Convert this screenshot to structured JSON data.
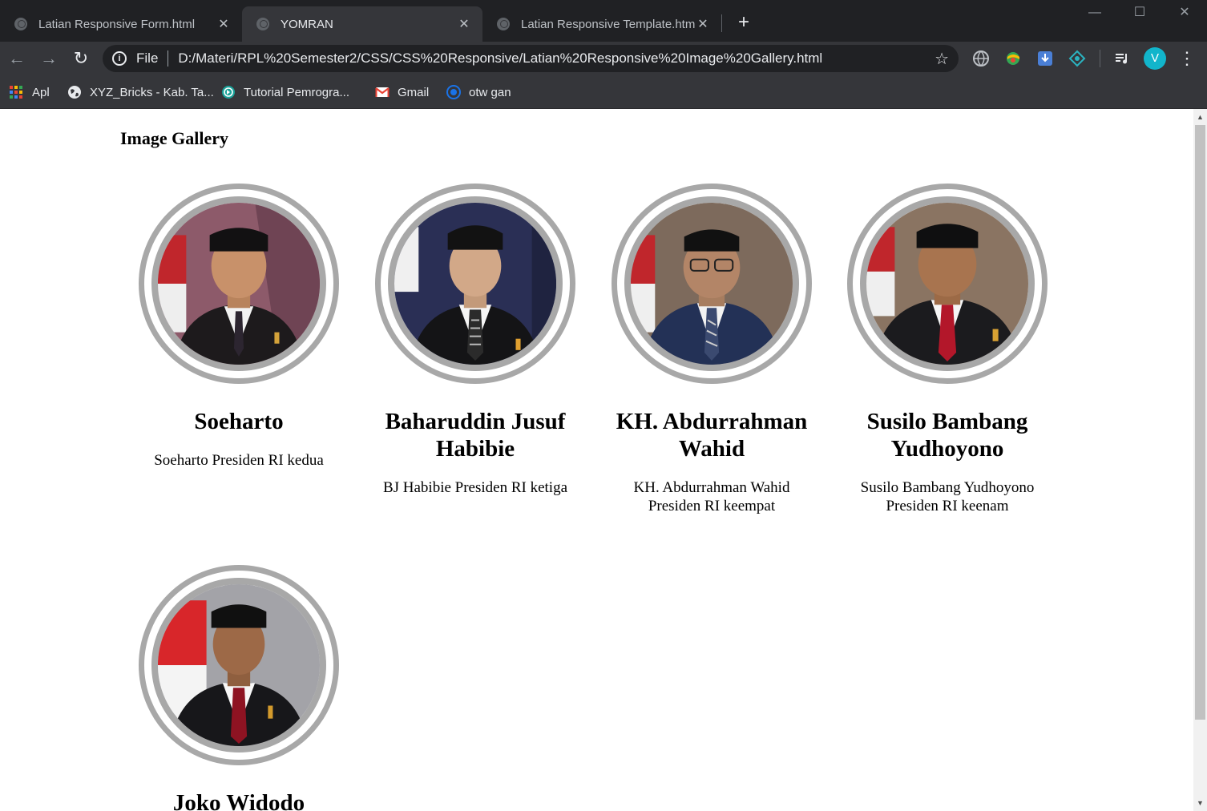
{
  "browser": {
    "tabs": [
      {
        "title": "Latian Responsive Form.html",
        "active": false
      },
      {
        "title": "YOMRAN",
        "active": true
      },
      {
        "title": "Latian Responsive Template.html",
        "active": false
      }
    ],
    "tab_close_glyph": "✕",
    "new_tab_glyph": "+",
    "window_controls": {
      "minimize": "—",
      "maximize": "☐",
      "close": "✕"
    },
    "nav": {
      "back": "←",
      "forward": "→",
      "reload": "↻",
      "menu": "⋮"
    },
    "address": {
      "scheme_label": "File",
      "url": "D:/Materi/RPL%20Semester2/CSS/CSS%20Responsive/Latian%20Responsive%20Image%20Gallery.html",
      "bookmark_star": "☆"
    },
    "profile_initial": "V",
    "extension_icons": [
      "globe-extension-icon",
      "colorful-extension-icon",
      "download-extension-icon",
      "teal-extension-icon",
      "media-control-icon"
    ],
    "bookmarks": [
      {
        "label": "Apl",
        "icon": "apps-grid-icon"
      },
      {
        "label": "XYZ_Bricks - Kab. Ta...",
        "icon": "globe-icon"
      },
      {
        "label": "Tutorial Pemrogra...",
        "icon": "teal-circle-icon"
      },
      {
        "label": "Gmail",
        "icon": "gmail-icon"
      },
      {
        "label": "otw gan",
        "icon": "blue-circle-icon"
      }
    ]
  },
  "page": {
    "heading": "Image Gallery",
    "cards": [
      {
        "name": "Soeharto",
        "desc": "Soeharto Presiden RI kedua"
      },
      {
        "name": "Baharuddin Jusuf Habibie",
        "desc": "BJ Habibie Presiden RI ketiga"
      },
      {
        "name": "KH. Abdurrahman Wahid",
        "desc": "KH. Abdurrahman Wahid Presiden RI keempat"
      },
      {
        "name": "Susilo Bambang Yudhoyono",
        "desc": "Susilo Bambang Yudhoyono Presiden RI keenam"
      },
      {
        "name": "Joko Widodo",
        "desc": ""
      }
    ]
  },
  "colors": {
    "chrome_dark": "#202124",
    "chrome_toolbar": "#35363a",
    "ring_gray": "#a8a8a8",
    "flag_red": "#d8262a"
  }
}
